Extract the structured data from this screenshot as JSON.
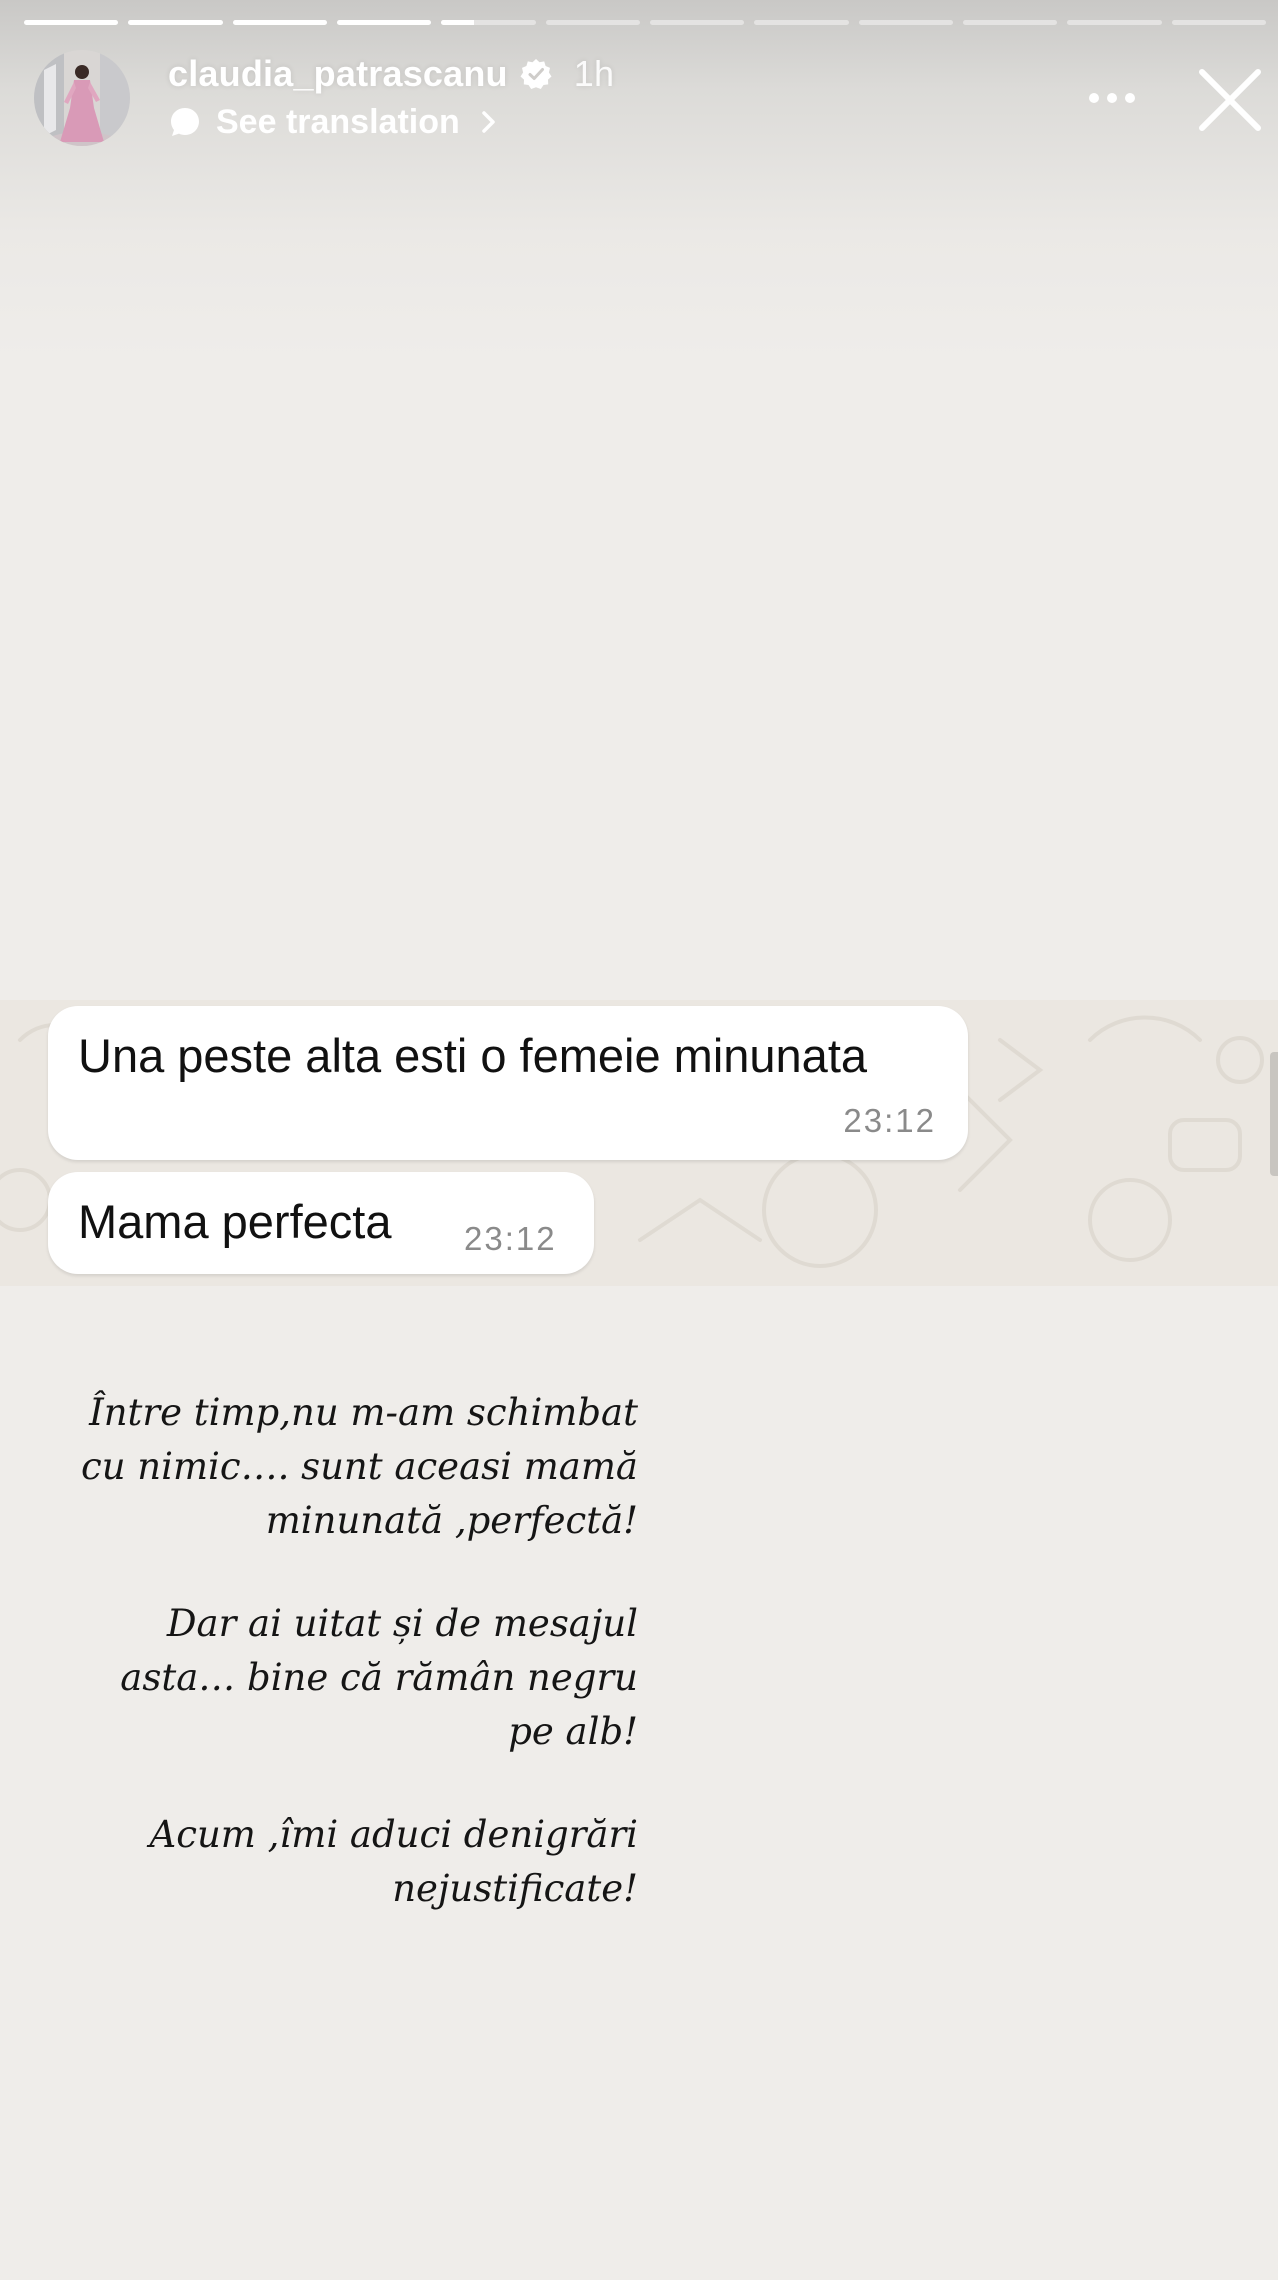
{
  "story": {
    "segments_total": 12,
    "segments_completed": 4,
    "current_segment_progress": 0.35
  },
  "header": {
    "username": "claudia_patrascanu",
    "time_ago": "1h",
    "see_translation": "See translation",
    "verified_icon": "verified-badge-icon",
    "more_icon": "more-horizontal-icon",
    "close_icon": "close-icon"
  },
  "chat": {
    "messages": [
      {
        "text": "Una peste alta esti o femeie minunata",
        "time": "23:12"
      },
      {
        "text": "Mama perfecta",
        "time": "23:12"
      }
    ]
  },
  "caption": {
    "paragraph1": [
      "Între timp,nu m-am schimbat",
      "cu nimic…. sunt aceasi mamă",
      "minunată ,perfectă!"
    ],
    "paragraph2": [
      "Dar  ai uitat și de mesajul",
      "asta… bine că rămân negru",
      "pe alb!"
    ],
    "paragraph3": [
      "Acum ,îmi aduci denigrări",
      "nejustificate!"
    ]
  },
  "colors": {
    "background": "#efedea",
    "bubble": "#ffffff",
    "chat_background": "#ebe7e1",
    "text": "#151515"
  }
}
